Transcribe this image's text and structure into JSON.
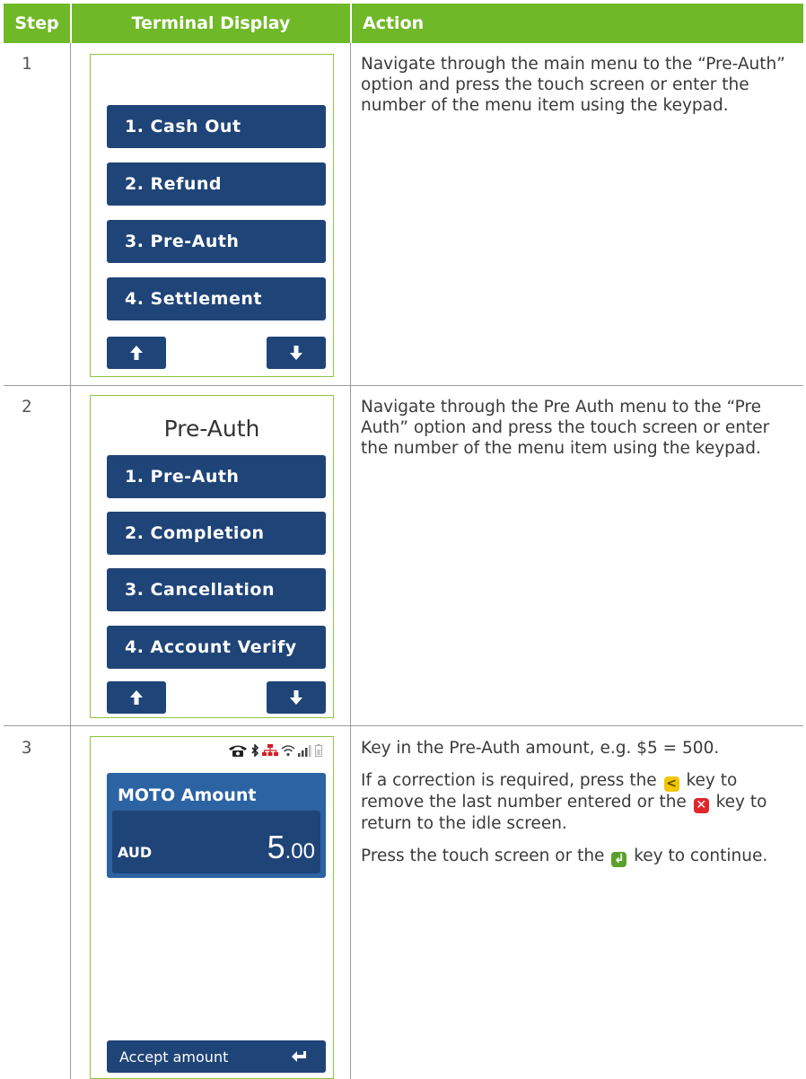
{
  "header": {
    "step": "Step",
    "terminal": "Terminal Display",
    "action": "Action"
  },
  "rows": [
    {
      "step": "1",
      "menu_items": [
        "1. Cash Out",
        "2. Refund",
        "3. Pre-Auth",
        "4. Settlement"
      ],
      "action": {
        "p1": "Navigate through the main menu to the “Pre-Auth” option and press the touch screen or enter the number of the menu item using the keypad."
      }
    },
    {
      "step": "2",
      "screen_title": "Pre-Auth",
      "menu_items": [
        "1. Pre-Auth",
        "2. Completion",
        "3. Cancellation",
        "4. Account Verify"
      ],
      "action": {
        "p1": "Navigate through the Pre Auth menu to the “Pre Auth” option and press the touch screen or enter the number of the menu item using the keypad."
      }
    },
    {
      "step": "3",
      "amount_label": "MOTO Amount",
      "currency": "AUD",
      "amount_main": "5",
      "amount_cents": ".00",
      "accept_label": "Accept amount",
      "action": {
        "p1": "Key in the Pre-Auth amount, e.g. $5 = 500.",
        "p2a": "If a correction is required, press the",
        "p2b": "key to remove the last number entered or the",
        "p2c": "key to return to the idle screen.",
        "p3a": "Press the touch screen or the",
        "p3b": "key to continue."
      }
    }
  ],
  "colors": {
    "header_green": "#6fb827",
    "button_navy": "#1f4478",
    "screen_border": "#8dc63f",
    "key_yellow": "#f2c600",
    "key_red": "#e0262b",
    "key_green": "#5aa02c"
  },
  "icons": [
    "up-arrow-icon",
    "down-arrow-icon",
    "telephone-icon",
    "bluetooth-icon",
    "network-icon",
    "wifi-icon",
    "signal-bars-icon",
    "battery-icon",
    "enter-icon",
    "backspace-key-icon",
    "cancel-key-icon",
    "enter-key-icon"
  ]
}
